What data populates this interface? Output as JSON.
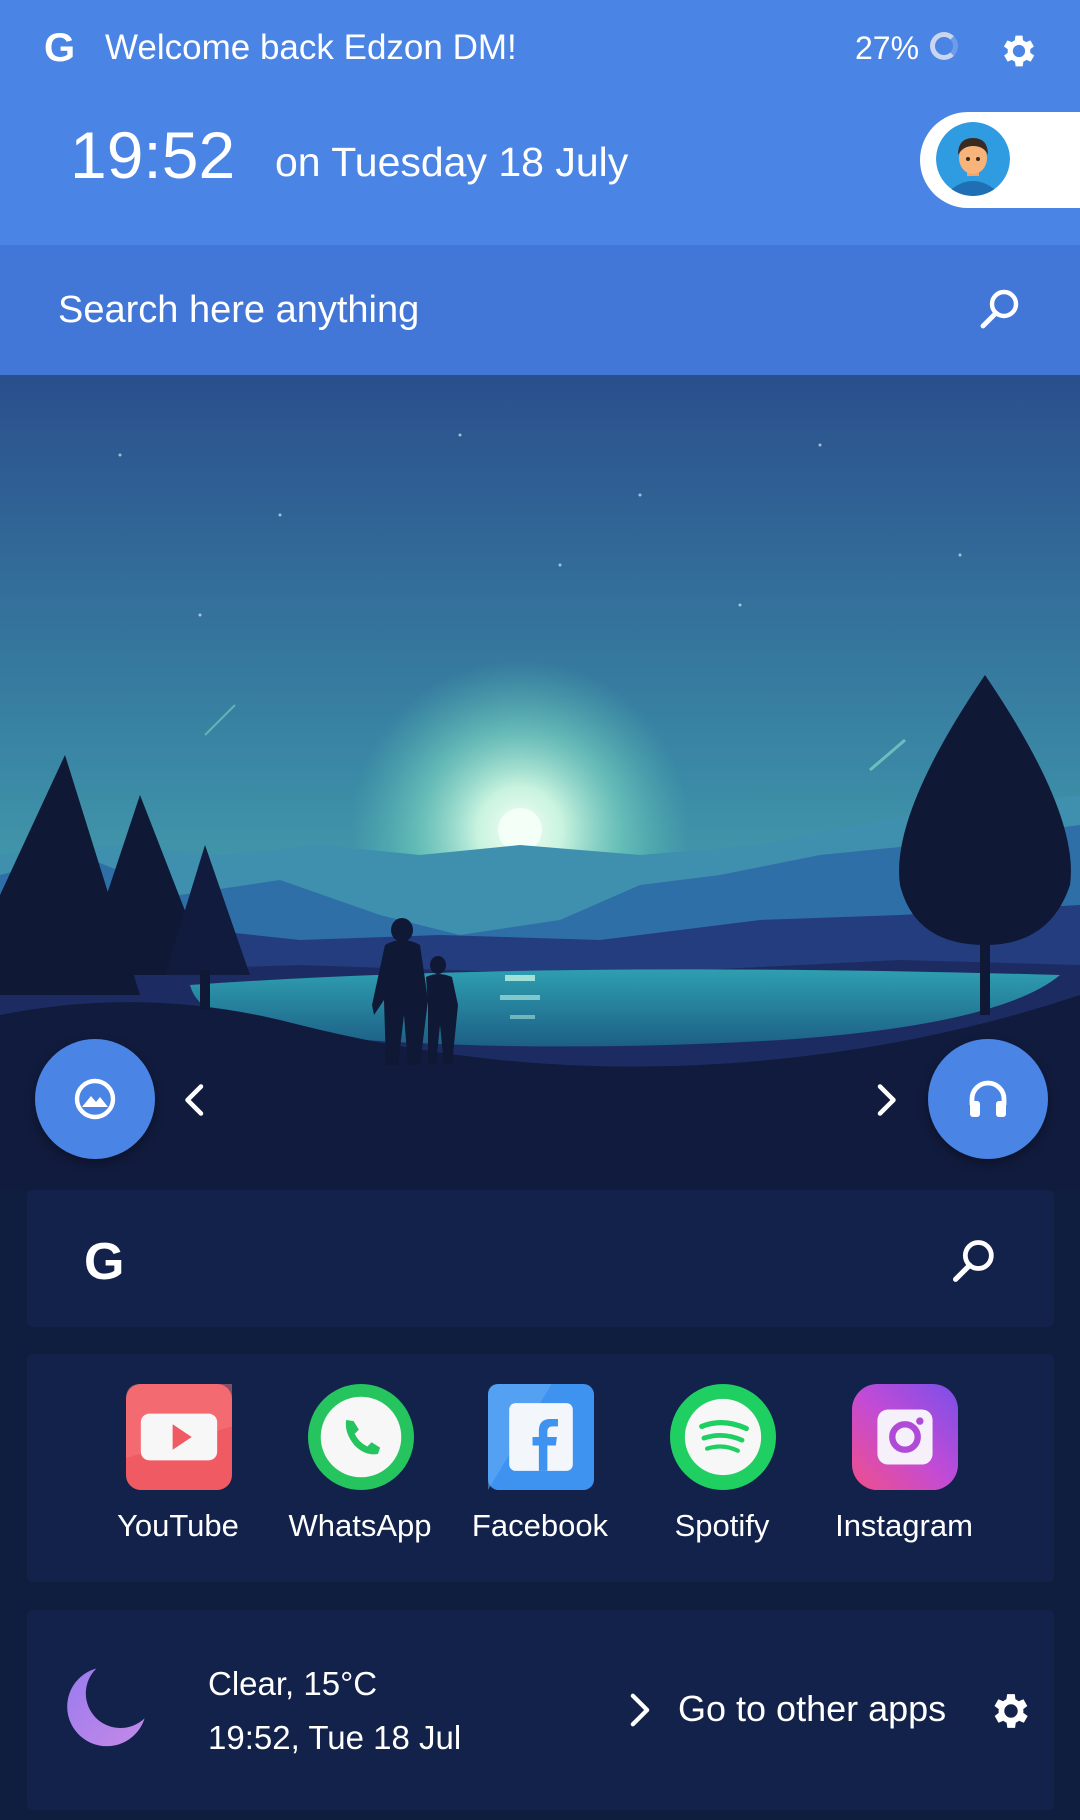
{
  "header": {
    "greeting": "Welcome back Edzon DM!",
    "battery": "27%",
    "time": "19:52",
    "date": "on Tuesday 18 July"
  },
  "search": {
    "placeholder": "Search here anything"
  },
  "apps": [
    {
      "label": "YouTube",
      "icon": "youtube-icon",
      "color": "#f05a62"
    },
    {
      "label": "WhatsApp",
      "icon": "whatsapp-icon",
      "color": "#25c45f"
    },
    {
      "label": "Facebook",
      "icon": "facebook-icon",
      "color": "#3f93f0"
    },
    {
      "label": "Spotify",
      "icon": "spotify-icon",
      "color": "#1fcf62"
    },
    {
      "label": "Instagram",
      "icon": "instagram-icon",
      "color": "#b04bd8"
    }
  ],
  "weather": {
    "condition": "Clear, 15°C",
    "datetime": "19:52, Tue 18 Jul",
    "go_label": "Go to other apps"
  },
  "colors": {
    "header": "#4a84e4",
    "search": "#4277d8",
    "widget": "#13224a"
  }
}
